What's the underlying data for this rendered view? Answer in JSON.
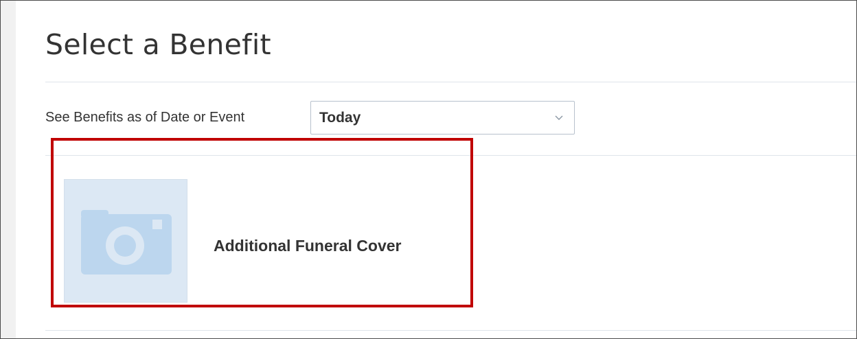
{
  "page": {
    "title": "Select a Benefit"
  },
  "filter": {
    "label": "See Benefits as of Date or Event",
    "selected_value": "Today",
    "chevron_icon": "chevron-down-icon"
  },
  "benefits": [
    {
      "name": "Additional Funeral Cover",
      "image_icon": "camera-icon"
    }
  ],
  "colors": {
    "highlight": "#c00000",
    "thumbnail_bg": "#dce8f4",
    "camera_icon": "#bcd6ee"
  }
}
